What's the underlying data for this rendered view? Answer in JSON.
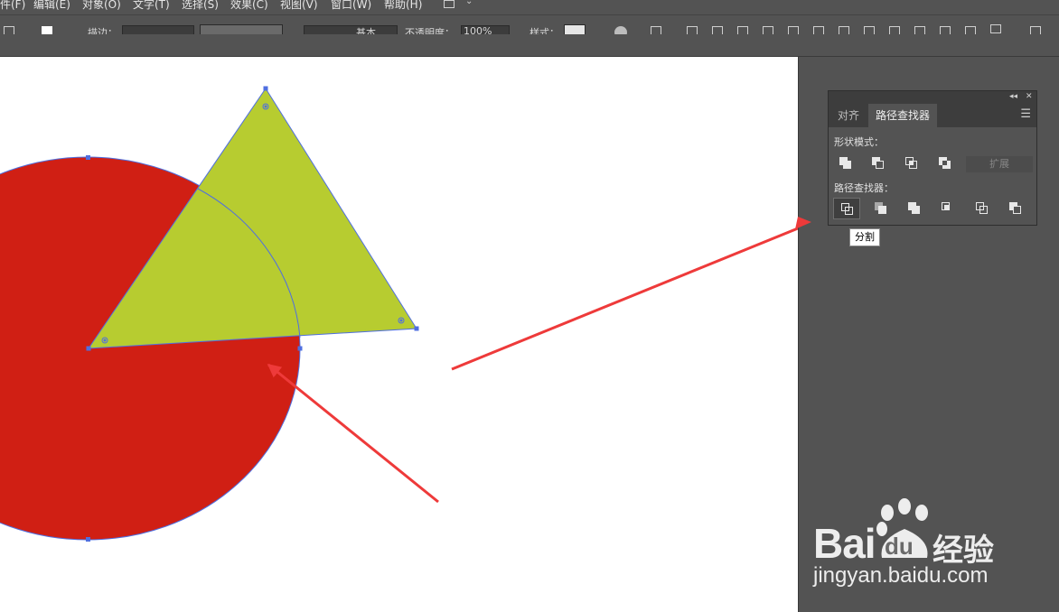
{
  "menu": [
    "件(F)",
    "编辑(E)",
    "对象(O)",
    "文字(T)",
    "选择(S)",
    "效果(C)",
    "视图(V)",
    "窗口(W)",
    "帮助(H)"
  ],
  "toolbar": {
    "stroke_label": "描边：",
    "basic_label": "基本",
    "opacity_label": "不透明度：",
    "opacity_value": "100%",
    "style_label": "样式："
  },
  "panel": {
    "tabs": [
      "对齐",
      "路径查找器"
    ],
    "active_tab": "路径查找器",
    "shape_modes_label": "形状模式：",
    "expand_label": "扩展",
    "pathfinders_label": "路径查找器：",
    "tooltip": "分割"
  },
  "colors": {
    "circle": "#d01f14",
    "triangle": "#b7cc30",
    "selection": "#4f6fe0",
    "arrow": "#ee3a3a"
  },
  "watermark": {
    "brand": "Bai",
    "brand_du": "du",
    "jingyan": "经验",
    "url": "jingyan.baidu.com"
  }
}
